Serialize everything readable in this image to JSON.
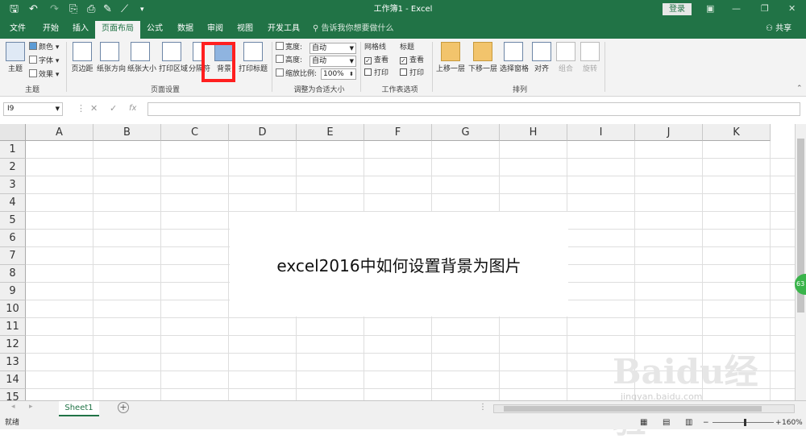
{
  "window": {
    "title": "工作簿1 - Excel",
    "login": "登录",
    "share": "共享"
  },
  "tabs": [
    "文件",
    "开始",
    "插入",
    "页面布局",
    "公式",
    "数据",
    "审阅",
    "视图",
    "开发工具"
  ],
  "tell_me": "告诉我你想要做什么",
  "ribbon": {
    "theme": {
      "big": "主题",
      "colors": "颜色",
      "fonts": "字体",
      "effects": "效果",
      "group": "主题"
    },
    "page_setup": {
      "margins": "页边距",
      "orientation": "纸张方向",
      "size": "纸张大小",
      "print_area": "打印区域",
      "breaks": "分隔符",
      "background": "背景",
      "print_titles": "打印标题",
      "group": "页面设置"
    },
    "scale": {
      "width_label": "宽度:",
      "width_value": "自动",
      "height_label": "高度:",
      "height_value": "自动",
      "scale_label": "缩放比例:",
      "scale_value": "100%",
      "group": "调整为合适大小"
    },
    "sheet_options": {
      "gridlines": "网格线",
      "headings": "标题",
      "view1": "查看",
      "view2": "查看",
      "print1": "打印",
      "print2": "打印",
      "group": "工作表选项"
    },
    "arrange": {
      "bring_forward": "上移一层",
      "send_backward": "下移一层",
      "selection_pane": "选择窗格",
      "align": "对齐",
      "group_btn": "组合",
      "rotate": "旋转",
      "group": "排列"
    }
  },
  "name_box": "I9",
  "fx_icon": "fx",
  "columns": [
    "A",
    "B",
    "C",
    "D",
    "E",
    "F",
    "G",
    "H",
    "I",
    "J",
    "K"
  ],
  "rows": [
    "1",
    "2",
    "3",
    "4",
    "5",
    "6",
    "7",
    "8",
    "9",
    "10",
    "11",
    "12",
    "13",
    "14",
    "15"
  ],
  "overlay_text": "excel2016中如何设置背景为图片",
  "sheet_tab": "Sheet1",
  "status": {
    "ready": "就绪",
    "zoom": "160%"
  },
  "badge": "63",
  "watermark": {
    "brand": "Baidu经验",
    "url": "jingyan.baidu.com"
  },
  "colors": {
    "accent": "#217346",
    "highlight": "#ff1f1f"
  }
}
